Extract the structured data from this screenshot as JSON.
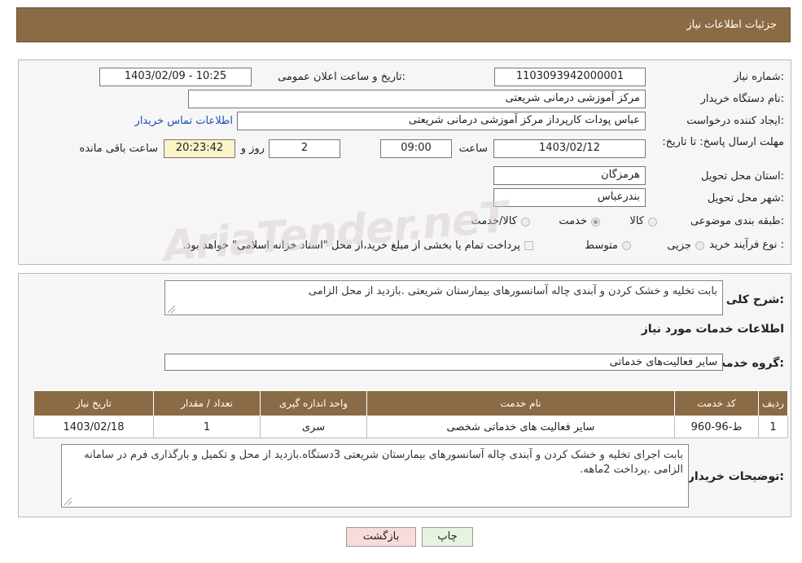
{
  "header": {
    "title": "جزئیات اطلاعات نیاز"
  },
  "watermark": "AriaTender.neT",
  "form": {
    "need_number": {
      "label": "شماره نیاز:",
      "value": "1103093942000001"
    },
    "announce_datetime": {
      "label": "تاریخ و ساعت اعلان عمومی:",
      "value": "1403/02/09 - 10:25"
    },
    "buyer_org": {
      "label": "نام دستگاه خریدار:",
      "value": "مرکز آموزشی  درمانی شریعتی"
    },
    "requester": {
      "label": "ایجاد کننده درخواست:",
      "value": "عباس پودات کارپرداز مرکز آموزشی  درمانی شریعتی",
      "contact_link": "اطلاعات تماس خریدار"
    },
    "deadline": {
      "label": "مهلت ارسال پاسخ: تا تاریخ:",
      "date": "1403/02/12",
      "time_label": "ساعت",
      "time": "09:00",
      "days": "2",
      "days_label": "روز و",
      "remaining": "20:23:42",
      "remaining_label": "ساعت باقی مانده"
    },
    "province": {
      "label": "استان محل تحویل:",
      "value": "هرمزگان"
    },
    "city": {
      "label": "شهر محل تحویل:",
      "value": "بندرعباس"
    },
    "category": {
      "label": "طبقه بندی موضوعی:",
      "options": [
        "کالا",
        "خدمت",
        "کالا/خدمت"
      ],
      "selected": "خدمت"
    },
    "purchase_type": {
      "label": "نوع فرآیند خرید :",
      "options": [
        "جزیی",
        "متوسط"
      ],
      "note": "پرداخت تمام یا بخشی از مبلغ خرید،از محل \"اسناد خزانه اسلامی\" خواهد بود."
    }
  },
  "details": {
    "summary_label": "شرح کلی نیاز:",
    "summary": "بابت تخلیه و خشک کردن و آبندی چاله آسانسورهای بیمارستان شریعتی .بازدید از محل الزامی",
    "services_title": "اطلاعات خدمات مورد نیاز",
    "service_group_label": "گروه خدمت:",
    "service_group": "سایر فعالیت‌های خدماتی",
    "table": {
      "headers": [
        "ردیف",
        "کد خدمت",
        "نام خدمت",
        "واحد اندازه گیری",
        "تعداد / مقدار",
        "تاریخ نیاز"
      ],
      "rows": [
        [
          "1",
          "ط-96-960",
          "سایر فعالیت های خدماتی شخصی",
          "سری",
          "1",
          "1403/02/18"
        ]
      ]
    },
    "buyer_notes_label": "توضیحات خریدار:",
    "buyer_notes": "بابت اجرای تخلیه و خشک کردن و آبندی چاله آسانسورهای بیمارستان شریعتی 3دستگاه.بازدید از محل و تکمیل و بارگذاری فرم در سامانه الزامی .پرداخت 2ماهه."
  },
  "buttons": {
    "print": "چاپ",
    "back": "بازگشت"
  }
}
